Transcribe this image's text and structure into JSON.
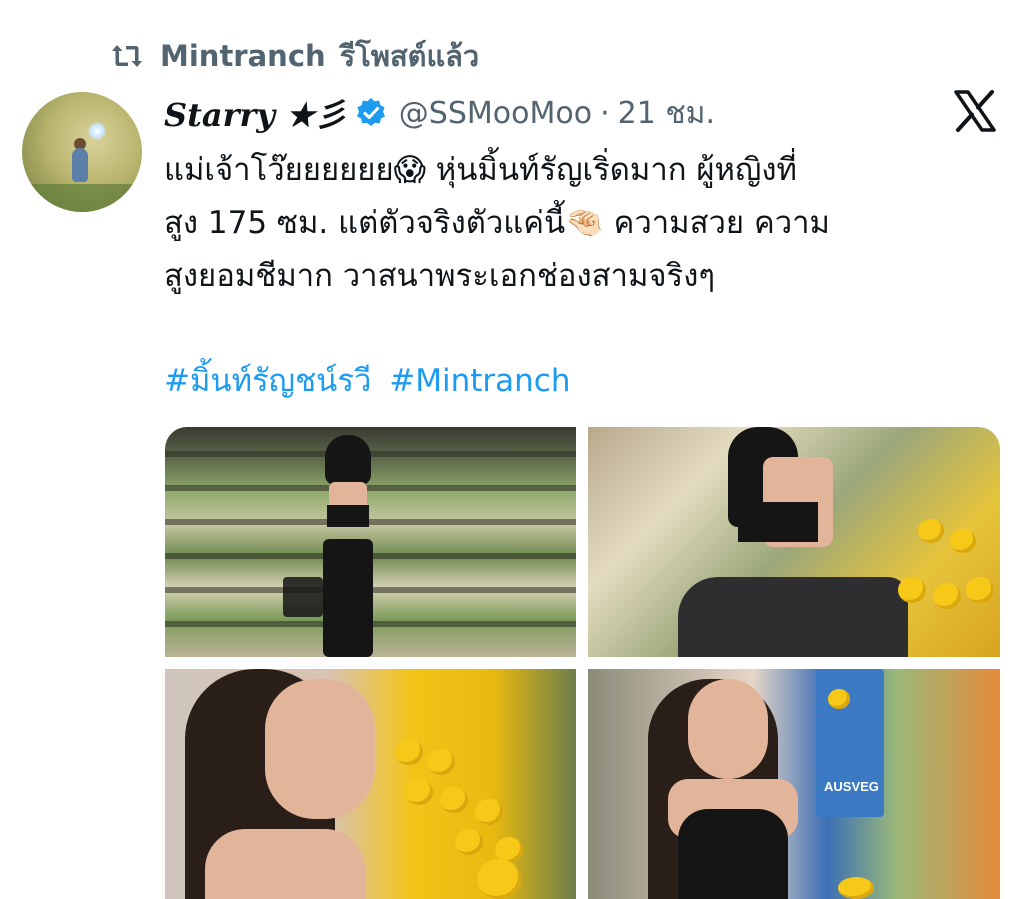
{
  "repost": {
    "icon": "repost-icon",
    "user": "Mintranch",
    "label": "รีโพสต์แล้ว"
  },
  "author": {
    "display_name": "Starry ★彡",
    "verified": true,
    "handle": "@SSMooMoo",
    "separator": "·",
    "time": "21 ชม."
  },
  "platform_logo": "x-logo",
  "tweet": {
    "line1": "แม่เจ้าโว๊ยยยยยย😱 หุ่นมิ้นท์รัญเริ่ดมาก ผู้หญิงที่",
    "line2": "สูง 175 ซม. แต่ตัวจริงตัวแค่นี้🤏🏻 ความสวย ความ",
    "line3": "สูงยอมชีมาก วาสนาพระเอกช่องสามจริงๆ"
  },
  "hashtags": [
    "#มิ้นท์รัญชน์รวี",
    "#Mintranch"
  ],
  "media": {
    "count": 4,
    "photos": [
      {
        "name": "photo-grocery-aisle"
      },
      {
        "name": "photo-picking-lemons"
      },
      {
        "name": "photo-lemon-display"
      },
      {
        "name": "photo-smiling-woman"
      }
    ],
    "sign_text": "AUSVEG"
  },
  "colors": {
    "link": "#1d9bf0",
    "muted": "#536471",
    "verified": "#1d9bf0",
    "text": "#0f1419"
  }
}
